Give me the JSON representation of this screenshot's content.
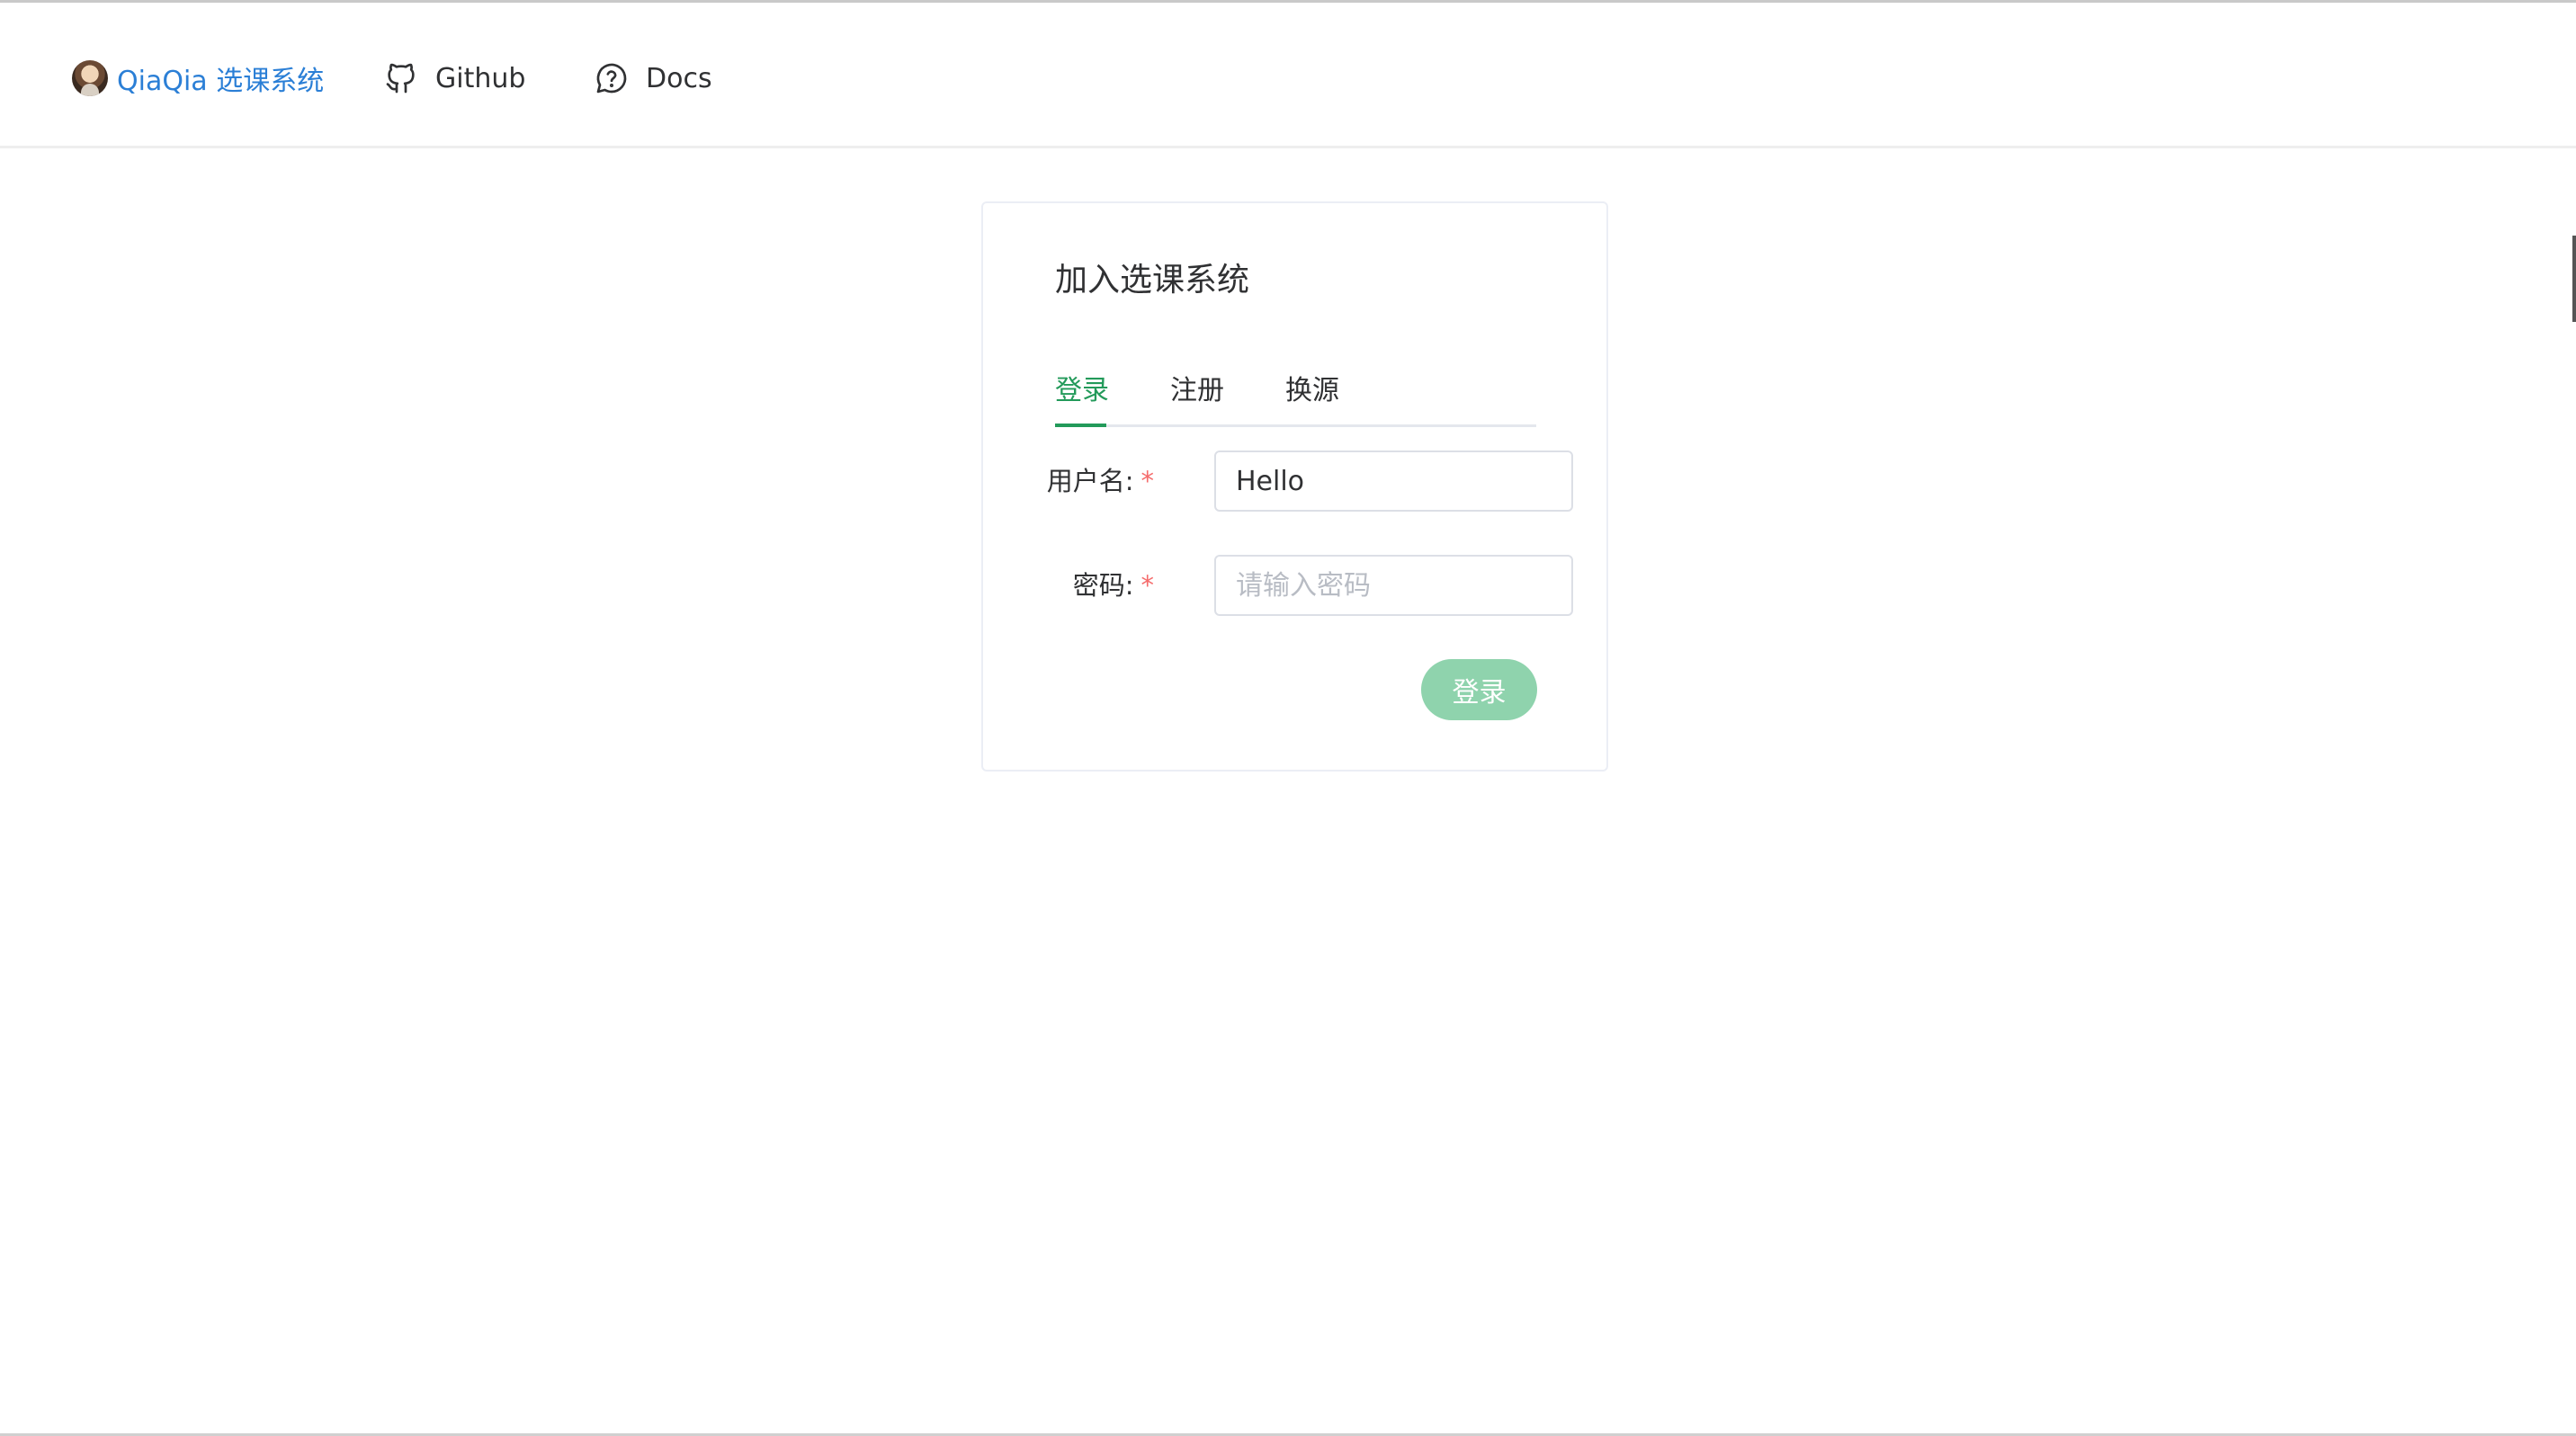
{
  "nav": {
    "brand_label": "QiaQia 选课系统",
    "github_label": "Github",
    "docs_label": "Docs",
    "icons": [
      "avatar",
      "github-icon",
      "help-circle-icon"
    ]
  },
  "card": {
    "title": "加入选课系统",
    "tabs": [
      {
        "label": "登录",
        "active": true
      },
      {
        "label": "注册",
        "active": false
      },
      {
        "label": "换源",
        "active": false
      }
    ],
    "form": {
      "username_label": "用户名:",
      "username_value": "Hello",
      "password_label": "密码:",
      "password_placeholder": "请输入密码",
      "required_mark": "*",
      "submit_label": "登录"
    }
  },
  "colors": {
    "brand": "#2b7fd6",
    "accent": "#239a5a",
    "button": "#8fd3ad",
    "required": "#f56c6c"
  }
}
